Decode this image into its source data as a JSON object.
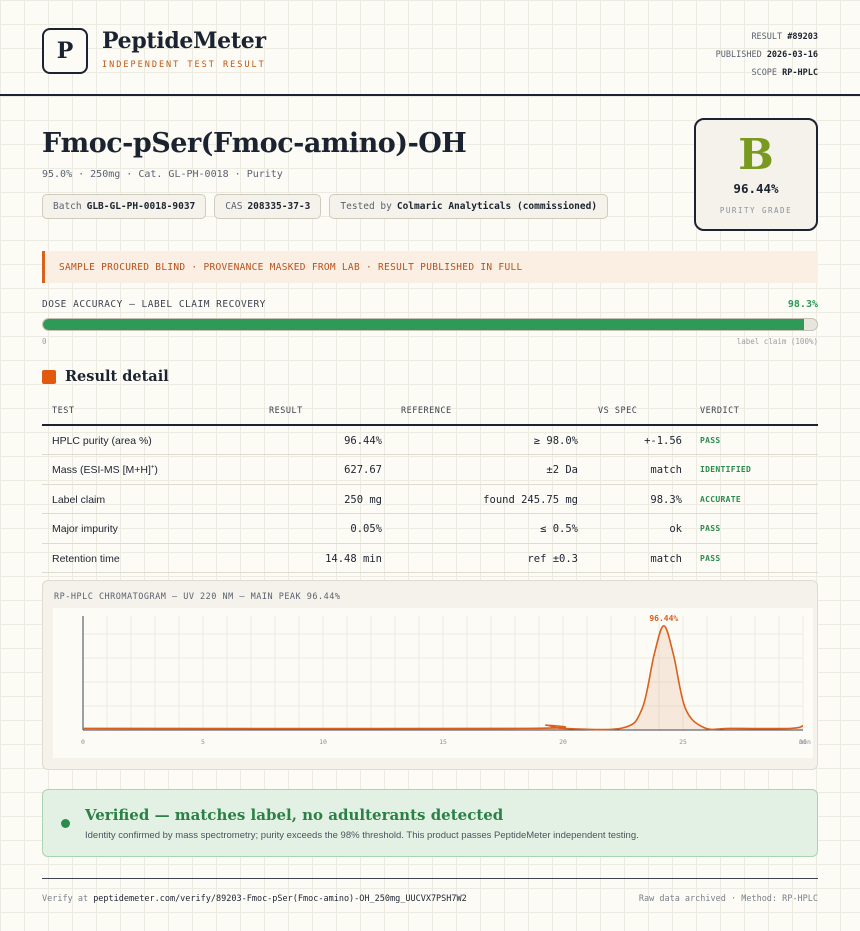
{
  "header": {
    "logo_letter": "P",
    "brand": "PeptideMeter",
    "brand_sub": "INDEPENDENT TEST RESULT",
    "result_label": "RESULT",
    "result_value": "#89203",
    "published_label": "PUBLISHED",
    "published_value": "2026-03-16",
    "scope_label": "SCOPE",
    "scope_value": "RP-HPLC"
  },
  "product": {
    "title": "Fmoc-pSer(Fmoc-amino)-OH",
    "subline": "95.0% · 250mg · Cat. GL-PH-0018 · Purity",
    "chips": {
      "batch_label": "Batch",
      "batch_value": "GLB-GL-PH-0018-9037",
      "cas_label": "CAS",
      "cas_value": "208335-37-3",
      "tested_label": "Tested by",
      "tested_value": "Colmaric Analyticals (commissioned)"
    }
  },
  "grade": {
    "letter": "B",
    "value": "96.44%",
    "label": "PURITY GRADE",
    "color": "#7a9a1f"
  },
  "notice": "SAMPLE PROCURED BLIND · PROVENANCE MASKED FROM LAB · RESULT PUBLISHED IN FULL",
  "dose": {
    "label": "DOSE ACCURACY — LABEL CLAIM RECOVERY",
    "value_text": "98.3%",
    "fraction": 0.983,
    "min_label": "0",
    "max_label": "label claim (100%)"
  },
  "section_title": "Result detail",
  "table": {
    "headers": {
      "test": "TEST",
      "result": "RESULT",
      "reference": "REFERENCE",
      "vs_spec": "VS SPEC",
      "verdict": "VERDICT"
    },
    "rows": [
      {
        "test": "HPLC purity (area %)",
        "result": "96.44%",
        "reference": "≥ 98.0%",
        "vs_spec": "+-1.56",
        "verdict": "PASS"
      },
      {
        "test": "Mass (ESI-MS [M+H]",
        "test_sup": "+",
        "test_end": ")",
        "result": "627.67",
        "reference": "±2 Da",
        "vs_spec": "match",
        "verdict": "IDENTIFIED"
      },
      {
        "test": "Label claim",
        "result": "250 mg",
        "reference": "found 245.75 mg",
        "vs_spec": "98.3%",
        "verdict": "ACCURATE"
      },
      {
        "test": "Major impurity",
        "result": "0.05%",
        "reference": "≤ 0.5%",
        "vs_spec": "ok",
        "verdict": "PASS"
      },
      {
        "test": "Retention time",
        "result": "14.48 min",
        "reference": "ref ±0.3",
        "vs_spec": "match",
        "verdict": "PASS"
      }
    ]
  },
  "chromatogram": {
    "title": "RP-HPLC CHROMATOGRAM — UV 220 NM — MAIN PEAK 96.44%",
    "peak_label": "96.44%",
    "x_ticks": [
      "0",
      "5",
      "10",
      "15",
      "20",
      "25",
      "30"
    ],
    "x_unit": "min",
    "line_color": "#d9601d"
  },
  "chart_data": {
    "type": "line",
    "title": "RP-HPLC CHROMATOGRAM — UV 220 NM — MAIN PEAK 96.44%",
    "xlabel": "min",
    "ylabel": "",
    "xlim": [
      0,
      30
    ],
    "ylim": [
      0,
      100
    ],
    "x_ticks": [
      0,
      5,
      10,
      15,
      20,
      25,
      30
    ],
    "grid": true,
    "series": [
      {
        "x": [
          0,
          18.5,
          19.3,
          20,
          22.5,
          23.3,
          23.8,
          24.2,
          24.6,
          25.1,
          25.9,
          27,
          29.5,
          30
        ],
        "values": [
          1.5,
          1.5,
          4.5,
          1.5,
          2,
          20,
          70,
          96.44,
          70,
          20,
          2,
          1.5,
          1.5,
          4
        ]
      }
    ],
    "annotations": [
      {
        "x": 24.2,
        "y": 96.44,
        "text": "96.44%"
      }
    ]
  },
  "verified": {
    "title": "Verified — matches label, no adulterants detected",
    "text": "Identity confirmed by mass spectrometry; purity exceeds the 98% threshold. This product passes PeptideMeter independent testing."
  },
  "footer": {
    "verify_prefix": "Verify at",
    "verify_url": "peptidemeter.com/verify/89203-Fmoc-pSer(Fmoc-amino)-OH_250mg_UUCVX7PSH7W2",
    "right_text": "Raw data archived · Method: RP-HPLC"
  }
}
